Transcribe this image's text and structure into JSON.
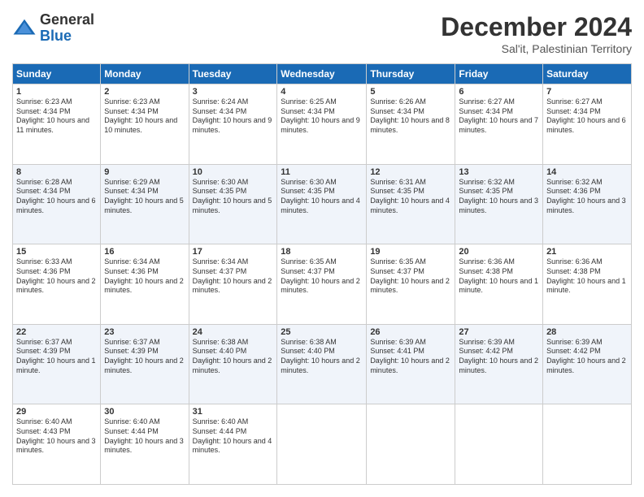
{
  "logo": {
    "line1": "General",
    "line2": "Blue"
  },
  "header": {
    "month": "December 2024",
    "location": "Sal'it, Palestinian Territory"
  },
  "weekdays": [
    "Sunday",
    "Monday",
    "Tuesday",
    "Wednesday",
    "Thursday",
    "Friday",
    "Saturday"
  ],
  "weeks": [
    [
      {
        "day": "1",
        "sunrise": "6:23 AM",
        "sunset": "4:34 PM",
        "daylight": "10 hours and 11 minutes."
      },
      {
        "day": "2",
        "sunrise": "6:23 AM",
        "sunset": "4:34 PM",
        "daylight": "10 hours and 10 minutes."
      },
      {
        "day": "3",
        "sunrise": "6:24 AM",
        "sunset": "4:34 PM",
        "daylight": "10 hours and 9 minutes."
      },
      {
        "day": "4",
        "sunrise": "6:25 AM",
        "sunset": "4:34 PM",
        "daylight": "10 hours and 9 minutes."
      },
      {
        "day": "5",
        "sunrise": "6:26 AM",
        "sunset": "4:34 PM",
        "daylight": "10 hours and 8 minutes."
      },
      {
        "day": "6",
        "sunrise": "6:27 AM",
        "sunset": "4:34 PM",
        "daylight": "10 hours and 7 minutes."
      },
      {
        "day": "7",
        "sunrise": "6:27 AM",
        "sunset": "4:34 PM",
        "daylight": "10 hours and 6 minutes."
      }
    ],
    [
      {
        "day": "8",
        "sunrise": "6:28 AM",
        "sunset": "4:34 PM",
        "daylight": "10 hours and 6 minutes."
      },
      {
        "day": "9",
        "sunrise": "6:29 AM",
        "sunset": "4:34 PM",
        "daylight": "10 hours and 5 minutes."
      },
      {
        "day": "10",
        "sunrise": "6:30 AM",
        "sunset": "4:35 PM",
        "daylight": "10 hours and 5 minutes."
      },
      {
        "day": "11",
        "sunrise": "6:30 AM",
        "sunset": "4:35 PM",
        "daylight": "10 hours and 4 minutes."
      },
      {
        "day": "12",
        "sunrise": "6:31 AM",
        "sunset": "4:35 PM",
        "daylight": "10 hours and 4 minutes."
      },
      {
        "day": "13",
        "sunrise": "6:32 AM",
        "sunset": "4:35 PM",
        "daylight": "10 hours and 3 minutes."
      },
      {
        "day": "14",
        "sunrise": "6:32 AM",
        "sunset": "4:36 PM",
        "daylight": "10 hours and 3 minutes."
      }
    ],
    [
      {
        "day": "15",
        "sunrise": "6:33 AM",
        "sunset": "4:36 PM",
        "daylight": "10 hours and 2 minutes."
      },
      {
        "day": "16",
        "sunrise": "6:34 AM",
        "sunset": "4:36 PM",
        "daylight": "10 hours and 2 minutes."
      },
      {
        "day": "17",
        "sunrise": "6:34 AM",
        "sunset": "4:37 PM",
        "daylight": "10 hours and 2 minutes."
      },
      {
        "day": "18",
        "sunrise": "6:35 AM",
        "sunset": "4:37 PM",
        "daylight": "10 hours and 2 minutes."
      },
      {
        "day": "19",
        "sunrise": "6:35 AM",
        "sunset": "4:37 PM",
        "daylight": "10 hours and 2 minutes."
      },
      {
        "day": "20",
        "sunrise": "6:36 AM",
        "sunset": "4:38 PM",
        "daylight": "10 hours and 1 minute."
      },
      {
        "day": "21",
        "sunrise": "6:36 AM",
        "sunset": "4:38 PM",
        "daylight": "10 hours and 1 minute."
      }
    ],
    [
      {
        "day": "22",
        "sunrise": "6:37 AM",
        "sunset": "4:39 PM",
        "daylight": "10 hours and 1 minute."
      },
      {
        "day": "23",
        "sunrise": "6:37 AM",
        "sunset": "4:39 PM",
        "daylight": "10 hours and 2 minutes."
      },
      {
        "day": "24",
        "sunrise": "6:38 AM",
        "sunset": "4:40 PM",
        "daylight": "10 hours and 2 minutes."
      },
      {
        "day": "25",
        "sunrise": "6:38 AM",
        "sunset": "4:40 PM",
        "daylight": "10 hours and 2 minutes."
      },
      {
        "day": "26",
        "sunrise": "6:39 AM",
        "sunset": "4:41 PM",
        "daylight": "10 hours and 2 minutes."
      },
      {
        "day": "27",
        "sunrise": "6:39 AM",
        "sunset": "4:42 PM",
        "daylight": "10 hours and 2 minutes."
      },
      {
        "day": "28",
        "sunrise": "6:39 AM",
        "sunset": "4:42 PM",
        "daylight": "10 hours and 2 minutes."
      }
    ],
    [
      {
        "day": "29",
        "sunrise": "6:40 AM",
        "sunset": "4:43 PM",
        "daylight": "10 hours and 3 minutes."
      },
      {
        "day": "30",
        "sunrise": "6:40 AM",
        "sunset": "4:44 PM",
        "daylight": "10 hours and 3 minutes."
      },
      {
        "day": "31",
        "sunrise": "6:40 AM",
        "sunset": "4:44 PM",
        "daylight": "10 hours and 4 minutes."
      },
      null,
      null,
      null,
      null
    ]
  ]
}
